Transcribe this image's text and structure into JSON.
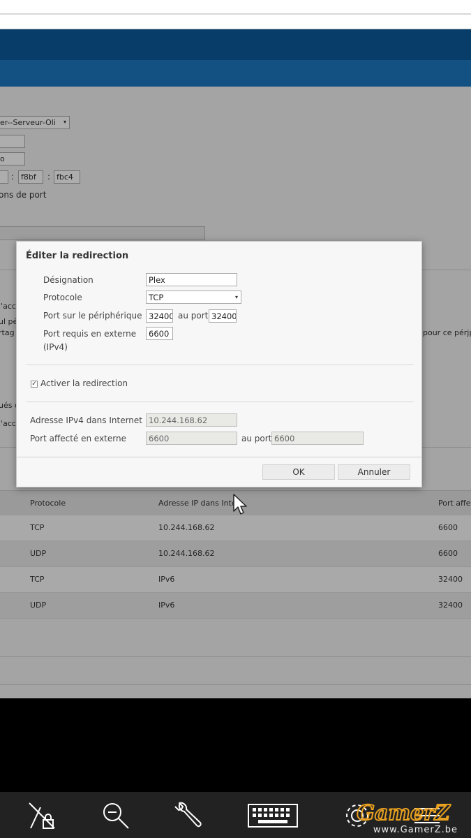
{
  "background": {
    "device_select": "er--Serveur-Oli",
    "ipv6_part_a": "f8bf",
    "ipv6_part_b": "fbc4",
    "ipv6_sep": ":",
    "field_stub": "o",
    "port_label_fragment": "ons de port",
    "fragment_acc1": "l'acc",
    "fragment_pe": "ul pé",
    "fragment_rtag": "rtag",
    "fragment_ues": "ués d",
    "fragment_acc2": "l'acc",
    "fragment_right": "pour ce pérjp"
  },
  "table": {
    "headers": [
      "Protocole",
      "Adresse IP dans Inter",
      "Port affe"
    ],
    "rows": [
      [
        "TCP",
        "10.244.168.62",
        "6600"
      ],
      [
        "UDP",
        "10.244.168.62",
        "6600"
      ],
      [
        "TCP",
        "IPv6",
        "32400"
      ],
      [
        "UDP",
        "IPv6",
        "32400"
      ]
    ]
  },
  "dialog": {
    "title": "Éditer la redirection",
    "designation_label": "Désignation",
    "designation_value": "Plex",
    "protocol_label": "Protocole",
    "protocol_value": "TCP",
    "device_port_label": "Port sur le périphérique",
    "device_port_from": "32400",
    "to_port_label": "au port",
    "device_port_to": "32400",
    "external_port_label_1": "Port requis en externe",
    "external_port_label_2": "(IPv4)",
    "external_port_value": "6600",
    "enable_label": "Activer la redirection",
    "enable_checked": true,
    "ipv4_label": "Adresse IPv4 dans Internet",
    "ipv4_value": "10.244.168.62",
    "assigned_port_label": "Port affecté en externe",
    "assigned_port_from": "6600",
    "assigned_to_label": "au port",
    "assigned_port_to": "6600",
    "ok_label": "OK",
    "cancel_label": "Annuler"
  },
  "watermark": {
    "brand": "GamerZ",
    "url": "www.GamerZ.be"
  },
  "icons": [
    "network-lock-icon",
    "zoom-out-icon",
    "wrench-icon",
    "keyboard-icon",
    "settings-icon",
    "menu-icon",
    "mouse-pointer-icon"
  ]
}
